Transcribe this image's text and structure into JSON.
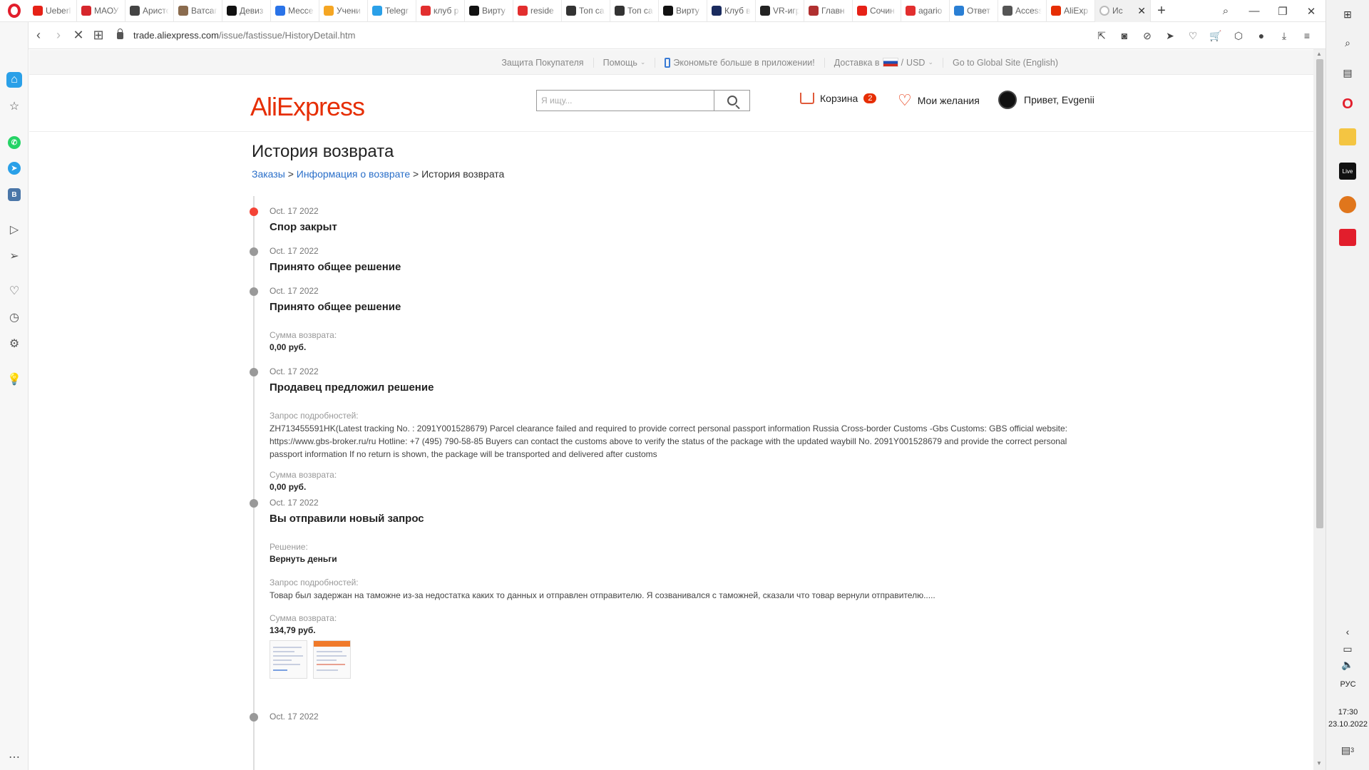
{
  "browser": {
    "tabs": [
      {
        "title": "Ueberl",
        "color": "#e62117"
      },
      {
        "title": "МАОУ",
        "color": "#d6262c"
      },
      {
        "title": "Аристо",
        "color": "#444444"
      },
      {
        "title": "Ватсап",
        "color": "#8a6b4e"
      },
      {
        "title": "Девиз",
        "color": "#111111"
      },
      {
        "title": "Мессе",
        "color": "#2a73e8"
      },
      {
        "title": "Учени",
        "color": "#f5a623"
      },
      {
        "title": "Telegr",
        "color": "#2aa0e8"
      },
      {
        "title": "клуб р",
        "color": "#e22e2e"
      },
      {
        "title": "Вирту",
        "color": "#111111"
      },
      {
        "title": "reside",
        "color": "#e22e2e"
      },
      {
        "title": "Топ са",
        "color": "#333333"
      },
      {
        "title": "Топ са",
        "color": "#333333"
      },
      {
        "title": "Вирту",
        "color": "#111111"
      },
      {
        "title": "Клуб в",
        "color": "#1a2b5e"
      },
      {
        "title": "VR-игр",
        "color": "#222222"
      },
      {
        "title": "Главн",
        "color": "#b03030"
      },
      {
        "title": "Сочин",
        "color": "#e62117"
      },
      {
        "title": "agario",
        "color": "#e22e2e"
      },
      {
        "title": "Ответ",
        "color": "#2a7fd4"
      },
      {
        "title": "Access",
        "color": "#555555"
      },
      {
        "title": "AliExp",
        "color": "#e62e04"
      },
      {
        "title": "Ис",
        "color": "#ffffff"
      }
    ],
    "url_prefix": "trade.aliexpress.com",
    "url_path": "/issue/fastissue/HistoryDetail.htm"
  },
  "topbar": {
    "buyer_protection": "Защита Покупателя",
    "help": "Помощь",
    "app_promo": "Экономьте больше в приложении!",
    "delivery": "Доставка в",
    "currency": "USD",
    "global_site": "Go to Global Site (English)"
  },
  "header": {
    "logo": "AliExpress",
    "search_placeholder": "Я ищу...",
    "cart_label": "Корзина",
    "cart_count": "2",
    "wishlist_label": "Мои желания",
    "greeting": "Привет, Evgenii"
  },
  "page": {
    "title": "История возврата",
    "breadcrumb": {
      "orders": "Заказы",
      "sep1": ">",
      "refund_info": "Информация о возврате",
      "sep2": ">",
      "current": "История возврата"
    }
  },
  "events": [
    {
      "date": "Oct. 17 2022",
      "title": "Спор закрыт"
    },
    {
      "date": "Oct. 17 2022",
      "title": "Принято общее решение"
    },
    {
      "date": "Oct. 17 2022",
      "title": "Принято общее решение",
      "amount_label": "Сумма возврата:",
      "amount": "0,00 руб."
    },
    {
      "date": "Oct. 17 2022",
      "title": "Продавец предложил решение",
      "details_label": "Запрос подробностей:",
      "details": "ZH713455591HK(Latest tracking No. : 2091Y001528679) Parcel clearance failed and required to provide correct personal passport information Russia Cross-border Customs -Gbs Customs: GBS official website: https://www.gbs-broker.ru/ru Hotline: +7 (495) 790-58-85 Buyers can contact the customs above to verify the status of the package with the updated waybill No. 2091Y001528679 and provide the correct personal passport information If no return is shown, the package will be transported and delivered after customs",
      "amount_label": "Сумма возврата:",
      "amount": "0,00 руб."
    },
    {
      "date": "Oct. 17 2022",
      "title": "Вы отправили новый запрос",
      "solution_label": "Решение:",
      "solution": "Вернуть деньги",
      "details_label": "Запрос подробностей:",
      "details": "Товар был задержан на таможне из-за недостатка каких то данных и отправлен отправителю. Я созванивался с таможней, сказали что товар вернули отправителю.....",
      "amount_label": "Сумма возврата:",
      "amount": "134,79 руб."
    },
    {
      "date": "Oct. 17 2022"
    }
  ],
  "system": {
    "language": "РУС",
    "time": "17:30",
    "date": "23.10.2022",
    "notifications": "3"
  }
}
